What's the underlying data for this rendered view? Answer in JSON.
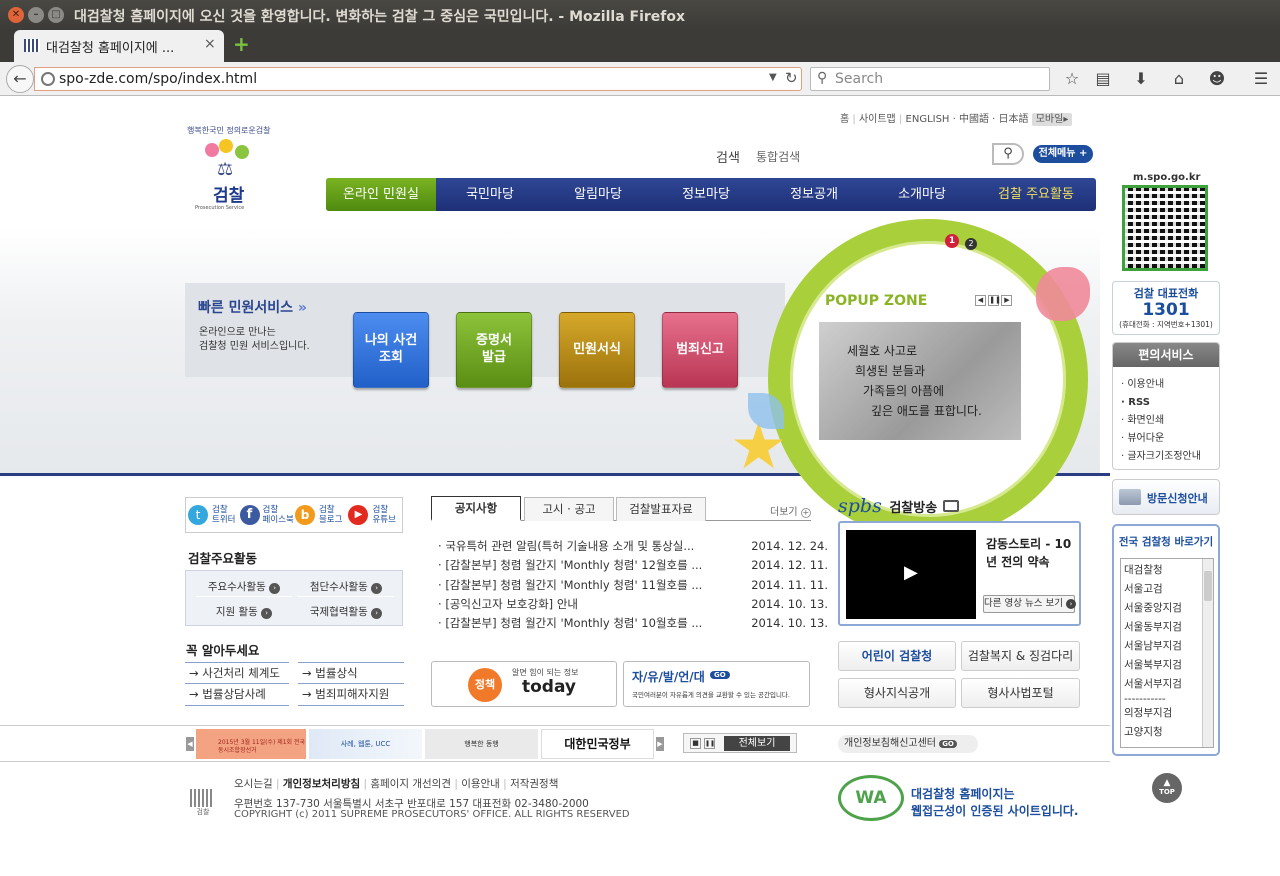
{
  "window": {
    "title": "대검찰청 홈페이지에 오신 것을 환영합니다. 변화하는 검찰 그 중심은 국민입니다. - Mozilla Firefox"
  },
  "tab": {
    "label": "대검찰청 홈페이지에 ...",
    "close": "×",
    "new_tab": "+"
  },
  "address_bar": {
    "url": "spo-zde.com/spo/index.html"
  },
  "search_bar": {
    "placeholder": "Search"
  },
  "topnav": {
    "home": "홈",
    "sitemap": "사이트맵",
    "english": "ENGLISH",
    "chinese": "中國語",
    "japanese": "日本語",
    "mobile": "모바일"
  },
  "logo": {
    "slogan": "행복한국민 정의로운검찰",
    "name": "검찰",
    "sub": "Prosecution Service"
  },
  "search": {
    "label": "검색",
    "option": "통합검색"
  },
  "all_menu": "전체메뉴",
  "gnb": [
    "온라인 민원실",
    "국민마당",
    "알림마당",
    "정보마당",
    "정보공개",
    "소개마당",
    "검찰 주요활동"
  ],
  "quick_service": {
    "title": "빠른 민원서비스",
    "desc1": "온라인으로 만나는",
    "desc2": "검찰청 민원 서비스입니다.",
    "buttons": [
      "나의 사건 조회",
      "증명서 발급",
      "민원서식",
      "범죄신고"
    ],
    "colors": [
      "#2f6fd0",
      "#6da21c",
      "#b88a12",
      "#c94564"
    ]
  },
  "popup": {
    "title": "POPUP ZONE",
    "page1": "1",
    "page2": "2",
    "lines": [
      "세월호 사고로",
      "희생된 분들과",
      "가족들의 아픔에",
      "깊은 애도를 표합니다."
    ]
  },
  "qr": {
    "url": "m.spo.go.kr"
  },
  "phone": {
    "label": "검찰 대표전화",
    "number": "1301",
    "sub": "(휴대전화 : 지역번호+1301)"
  },
  "convenience": {
    "title": "편의서비스",
    "items": [
      "이용안내",
      "RSS",
      "화면인쇄",
      "뷰어다운",
      "글자크기조정안내"
    ]
  },
  "visit": "방문신청안내",
  "shortcut": {
    "title": "전국 검찰청 바로가기",
    "items": [
      "대검찰청",
      "서울고검",
      "서울중앙지검",
      "서울동부지검",
      "서울남부지검",
      "서울북부지검",
      "서울서부지검",
      "-----------",
      "의정부지검",
      "고양지청"
    ]
  },
  "sns": [
    {
      "name": "검찰",
      "sub": "트위터"
    },
    {
      "name": "검찰",
      "sub": "페이스북"
    },
    {
      "name": "검찰",
      "sub": "블로그"
    },
    {
      "name": "검찰",
      "sub": "유튜브"
    }
  ],
  "activities": {
    "title": "검찰주요활동",
    "items": [
      "주요수사활동",
      "첨단수사활동",
      "지원 활동",
      "국제협력활동"
    ]
  },
  "must_know": {
    "title": "꼭 알아두세요",
    "items": [
      "사건처리 체계도",
      "법률상식",
      "법률상담사례",
      "범죄피해자지원"
    ]
  },
  "news": {
    "tabs": [
      "공지사항",
      "고시 · 공고",
      "검찰발표자료"
    ],
    "more": "더보기",
    "items": [
      {
        "title": "국유특허 관련 알림(특허 기술내용 소개 및 통상실...",
        "date": "2014. 12. 24."
      },
      {
        "title": "[감찰본부] 청렴 월간지 'Monthly 청렴' 12월호를 ...",
        "date": "2014. 12. 11."
      },
      {
        "title": "[감찰본부] 청렴 월간지 'Monthly 청렴' 11월호를 ...",
        "date": "2014. 11. 11."
      },
      {
        "title": "[공익신고자 보호강화] 안내",
        "date": "2014. 10. 13."
      },
      {
        "title": "[감찰본부] 청렴 월간지 'Monthly 청렴' 10월호를 ...",
        "date": "2014. 10. 13."
      }
    ]
  },
  "banners": {
    "policy_small": "알면 힘이 되는 정보",
    "policy_logo": "정책",
    "policy_today": "today",
    "free_title": "자/유/발/언/대",
    "free_go": "GO",
    "free_desc": "국민여러분이 자유롭게 의견을 교환할 수 있는 공간입니다."
  },
  "broadcast": {
    "logo": "spbs",
    "title": "검찰방송",
    "video_title": "감동스토리 - 10년 전의 약속",
    "more": "다른 영상 뉴스 보기"
  },
  "quick_links": [
    "어린이 검찰청",
    "검찰복지 & 징검다리",
    "형사지식공개",
    "형사사법포털"
  ],
  "banner_strip": {
    "gov": "대한민국정부",
    "view_all": "전체보기",
    "privacy": "개인정보침해신고센터",
    "go": "GO",
    "b1": "2015년 3월 11일(수) 제1회 전국동시조합장선거",
    "b2": "사례, 웹툰, UCC",
    "b3": "행복한 동행"
  },
  "footer": {
    "links": [
      "오시는길",
      "개인정보처리방침",
      "홈페이지 개선의견",
      "이용안내",
      "저작권정책"
    ],
    "address": "우편번호 137-730 서울특별시 서초구 반포대로 157 대표전화 02-3480-2000",
    "copyright": "COPYRIGHT (c) 2011 SUPREME PROSECUTORS' OFFICE. ALL RIGHTS RESERVED",
    "logo": "검찰",
    "wa_text1": "대검찰청 홈페이지는",
    "wa_text2": "웹접근성이 인증된 사이트입니다.",
    "wa_badge": "WA",
    "top": "TOP"
  }
}
